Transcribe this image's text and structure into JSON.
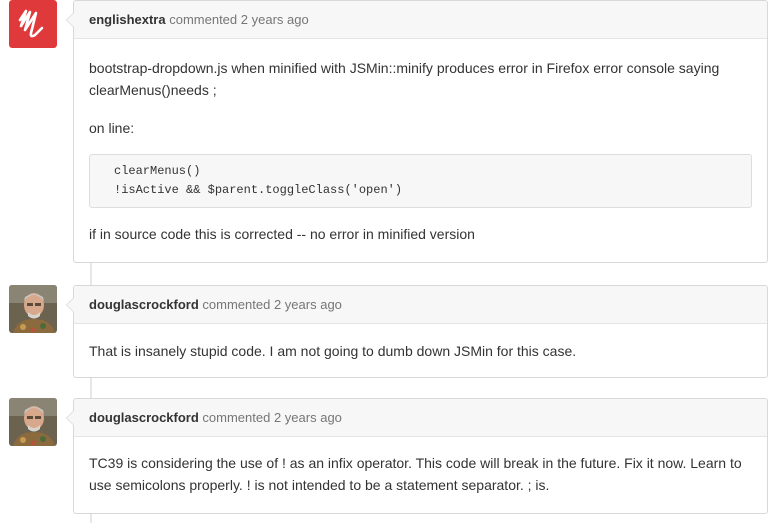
{
  "comments": [
    {
      "author": "englishextra",
      "action": "commented",
      "time": "2 years ago",
      "avatar_icon": "red-logo-avatar-icon",
      "paragraph1": "bootstrap-dropdown.js when minified with JSMin::minify produces error in Firefox error console saying clearMenus()needs ;",
      "paragraph2": "on line:",
      "code_line1": "clearMenus()",
      "code_line2": "!isActive && $parent.toggleClass('open')",
      "paragraph3": "if in source code this is corrected -- no error in minified version"
    },
    {
      "author": "douglascrockford",
      "action": "commented",
      "time": "2 years ago",
      "avatar_icon": "user-photo-avatar-icon",
      "paragraph1": "That is insanely stupid code. I am not going to dumb down JSMin for this case."
    },
    {
      "author": "douglascrockford",
      "action": "commented",
      "time": "2 years ago",
      "avatar_icon": "user-photo-avatar-icon",
      "paragraph1": "TC39 is considering the use of ! as an infix operator. This code will break in the future. Fix it now. Learn to use semicolons properly. ! is not intended to be a statement separator. ; is."
    }
  ],
  "colors": {
    "logo_red": "#e0393b",
    "header_bg": "#f7f7f7",
    "border": "#d8d8d8",
    "timeline": "#e7e7e7",
    "meta_text": "#767676"
  }
}
